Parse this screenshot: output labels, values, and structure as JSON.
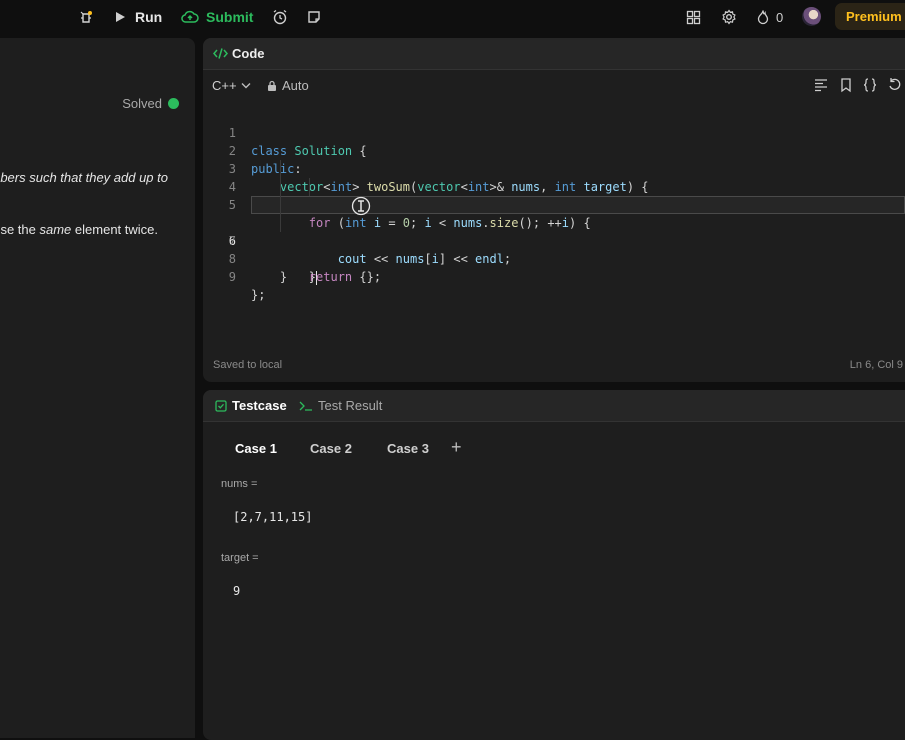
{
  "toolbar": {
    "run_label": "Run",
    "submit_label": "Submit",
    "streak_count": "0",
    "premium_label": "Premium"
  },
  "problem": {
    "status": "Solved",
    "desc_line1": "bers such that they add up to",
    "desc_line2_a": "se the ",
    "desc_line2_em": "same",
    "desc_line2_b": " element twice."
  },
  "editor": {
    "title": "Code",
    "language": "C++",
    "mode": "Auto",
    "footer_status": "Saved to local",
    "cursor_position": "Ln 6, Col 9",
    "active_line": 6,
    "line_numbers": [
      "1",
      "2",
      "3",
      "4",
      "5",
      "6",
      "7",
      "8",
      "9"
    ],
    "code_lines": [
      "class Solution {",
      "public:",
      "    vector<int> twoSum(vector<int>& nums, int target) {",
      "        for (int i = 0; i < nums.size(); ++i) {",
      "            cout << nums[i] << endl;",
      "        }",
      "        return {};",
      "    }",
      "};"
    ]
  },
  "testcase": {
    "tab_testcase": "Testcase",
    "tab_result": "Test Result",
    "cases": [
      "Case 1",
      "Case 2",
      "Case 3"
    ],
    "add_symbol": "+",
    "nums_label": "nums =",
    "nums_value": "[2,7,11,15]",
    "target_label": "target =",
    "target_value": "9"
  },
  "colors": {
    "accent_green": "#2cbb5d",
    "premium_gold": "#ffc01e"
  }
}
